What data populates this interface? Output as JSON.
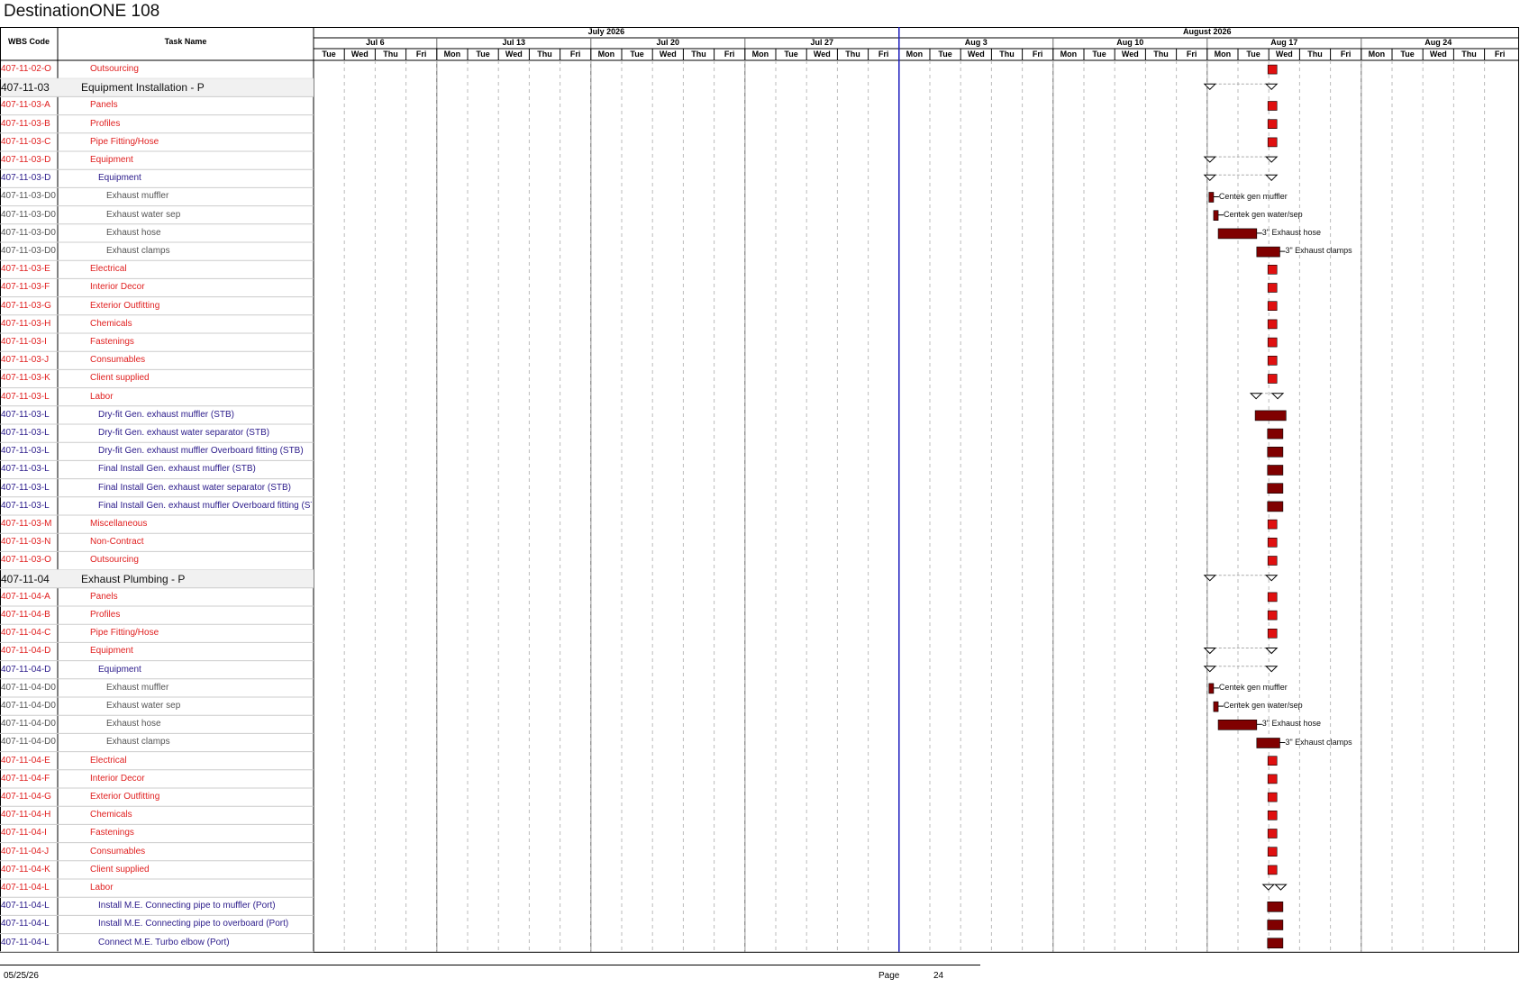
{
  "title": "DestinationONE 108",
  "columns": {
    "wbs": "WBS Code",
    "task": "Task Name"
  },
  "months": [
    "July 2026",
    "August 2026"
  ],
  "weeks": [
    "Jul 6",
    "Jul 13",
    "Jul 20",
    "Jul 27",
    "Aug 3",
    "Aug 10",
    "Aug 17",
    "Aug 24"
  ],
  "days": [
    "Tue",
    "Wed",
    "Thu",
    "Fri",
    "Mon",
    "Tue",
    "Wed",
    "Thu",
    "Fri",
    "Mon",
    "Tue",
    "Wed",
    "Thu",
    "Fri",
    "Mon",
    "Tue",
    "Wed",
    "Thu",
    "Fri",
    "Mon",
    "Tue",
    "Wed",
    "Thu",
    "Fri",
    "Mon",
    "Tue",
    "Wed",
    "Thu",
    "Fri",
    "Mon",
    "Tue",
    "Wed",
    "Thu",
    "Fri",
    "Mon",
    "Tue",
    "Wed",
    "Thu",
    "Fri"
  ],
  "colors": {
    "red_text": "#e02020",
    "blue_text": "#2a1a8a",
    "milestone": "#e01010",
    "task_bar": "#800000",
    "today_line": "#2020c0"
  },
  "rows": [
    {
      "wbs": "407-11-02-O",
      "task": "Outsourcing",
      "style": "red",
      "indent": 1,
      "bar": {
        "kind": "milestone",
        "day": 31
      }
    },
    {
      "wbs": "407-11-03",
      "task": "Equipment Installation - P",
      "style": "big",
      "indent": 0,
      "bar": {
        "kind": "summary",
        "start": 29,
        "end": 31
      }
    },
    {
      "wbs": "407-11-03-A",
      "task": "Panels",
      "style": "red",
      "indent": 1,
      "bar": {
        "kind": "milestone",
        "day": 31
      }
    },
    {
      "wbs": "407-11-03-B",
      "task": "Profiles",
      "style": "red",
      "indent": 1,
      "bar": {
        "kind": "milestone",
        "day": 31
      }
    },
    {
      "wbs": "407-11-03-C",
      "task": "Pipe Fitting/Hose",
      "style": "red",
      "indent": 1,
      "bar": {
        "kind": "milestone",
        "day": 31
      }
    },
    {
      "wbs": "407-11-03-D",
      "task": "Equipment",
      "style": "red",
      "indent": 1,
      "bar": {
        "kind": "summary",
        "start": 29,
        "end": 31
      }
    },
    {
      "wbs": "407-11-03-D",
      "task": "Equipment",
      "style": "blue",
      "indent": 2,
      "bar": {
        "kind": "summary",
        "start": 29,
        "end": 31
      }
    },
    {
      "wbs": "407-11-03-D0",
      "task": "Exhaust muffler",
      "style": "gray",
      "indent": 3,
      "bar": {
        "kind": "task",
        "start": 29.0,
        "end": 29.15,
        "label": "Centek gen muffler"
      }
    },
    {
      "wbs": "407-11-03-D0",
      "task": "Exhaust water sep",
      "style": "gray",
      "indent": 3,
      "bar": {
        "kind": "task",
        "start": 29.15,
        "end": 29.3,
        "label": "Centek gen water/sep"
      }
    },
    {
      "wbs": "407-11-03-D0",
      "task": "Exhaust hose",
      "style": "gray",
      "indent": 3,
      "bar": {
        "kind": "task",
        "start": 29.3,
        "end": 30.55,
        "label": "3\" Exhaust hose"
      }
    },
    {
      "wbs": "407-11-03-D0",
      "task": "Exhaust clamps",
      "style": "gray",
      "indent": 3,
      "bar": {
        "kind": "task",
        "start": 30.55,
        "end": 31.3,
        "label": "3\" Exhaust clamps"
      }
    },
    {
      "wbs": "407-11-03-E",
      "task": "Electrical",
      "style": "red",
      "indent": 1,
      "bar": {
        "kind": "milestone",
        "day": 31
      }
    },
    {
      "wbs": "407-11-03-F",
      "task": "Interior Decor",
      "style": "red",
      "indent": 1,
      "bar": {
        "kind": "milestone",
        "day": 31
      }
    },
    {
      "wbs": "407-11-03-G",
      "task": "Exterior Outfitting",
      "style": "red",
      "indent": 1,
      "bar": {
        "kind": "milestone",
        "day": 31
      }
    },
    {
      "wbs": "407-11-03-H",
      "task": "Chemicals",
      "style": "red",
      "indent": 1,
      "bar": {
        "kind": "milestone",
        "day": 31
      }
    },
    {
      "wbs": "407-11-03-I",
      "task": "Fastenings",
      "style": "red",
      "indent": 1,
      "bar": {
        "kind": "milestone",
        "day": 31
      }
    },
    {
      "wbs": "407-11-03-J",
      "task": "Consumables",
      "style": "red",
      "indent": 1,
      "bar": {
        "kind": "milestone",
        "day": 31
      }
    },
    {
      "wbs": "407-11-03-K",
      "task": "Client supplied",
      "style": "red",
      "indent": 1,
      "bar": {
        "kind": "milestone",
        "day": 31
      }
    },
    {
      "wbs": "407-11-03-L",
      "task": "Labor",
      "style": "red",
      "indent": 1,
      "bar": {
        "kind": "summary",
        "start": 30.5,
        "end": 31.2
      }
    },
    {
      "wbs": "407-11-03-L",
      "task": "Dry-fit Gen. exhaust muffler (STB)",
      "style": "blue",
      "indent": 2,
      "bar": {
        "kind": "task",
        "start": 30.5,
        "end": 31.5
      }
    },
    {
      "wbs": "407-11-03-L",
      "task": "Dry-fit Gen. exhaust water separator (STB)",
      "style": "blue",
      "indent": 2,
      "bar": {
        "kind": "task",
        "start": 30.9,
        "end": 31.4
      }
    },
    {
      "wbs": "407-11-03-L",
      "task": "Dry-fit Gen. exhaust muffler Overboard fitting (STB)",
      "style": "blue",
      "indent": 2,
      "bar": {
        "kind": "task",
        "start": 30.9,
        "end": 31.4
      }
    },
    {
      "wbs": "407-11-03-L",
      "task": "Final Install Gen. exhaust muffler (STB)",
      "style": "blue",
      "indent": 2,
      "bar": {
        "kind": "task",
        "start": 30.9,
        "end": 31.4
      }
    },
    {
      "wbs": "407-11-03-L",
      "task": "Final Install Gen. exhaust water separator (STB)",
      "style": "blue",
      "indent": 2,
      "bar": {
        "kind": "task",
        "start": 30.9,
        "end": 31.4
      }
    },
    {
      "wbs": "407-11-03-L",
      "task": "Final Install Gen. exhaust muffler Overboard fitting (STB)",
      "style": "blue",
      "indent": 2,
      "bar": {
        "kind": "task",
        "start": 30.9,
        "end": 31.4
      }
    },
    {
      "wbs": "407-11-03-M",
      "task": "Miscellaneous",
      "style": "red",
      "indent": 1,
      "bar": {
        "kind": "milestone",
        "day": 31
      }
    },
    {
      "wbs": "407-11-03-N",
      "task": "Non-Contract",
      "style": "red",
      "indent": 1,
      "bar": {
        "kind": "milestone",
        "day": 31
      }
    },
    {
      "wbs": "407-11-03-O",
      "task": "Outsourcing",
      "style": "red",
      "indent": 1,
      "bar": {
        "kind": "milestone",
        "day": 31
      }
    },
    {
      "wbs": "407-11-04",
      "task": "Exhaust Plumbing - P",
      "style": "big",
      "indent": 0,
      "bar": {
        "kind": "summary",
        "start": 29,
        "end": 31
      }
    },
    {
      "wbs": "407-11-04-A",
      "task": "Panels",
      "style": "red",
      "indent": 1,
      "bar": {
        "kind": "milestone",
        "day": 31
      }
    },
    {
      "wbs": "407-11-04-B",
      "task": "Profiles",
      "style": "red",
      "indent": 1,
      "bar": {
        "kind": "milestone",
        "day": 31
      }
    },
    {
      "wbs": "407-11-04-C",
      "task": "Pipe Fitting/Hose",
      "style": "red",
      "indent": 1,
      "bar": {
        "kind": "milestone",
        "day": 31
      }
    },
    {
      "wbs": "407-11-04-D",
      "task": "Equipment",
      "style": "red",
      "indent": 1,
      "bar": {
        "kind": "summary",
        "start": 29,
        "end": 31
      }
    },
    {
      "wbs": "407-11-04-D",
      "task": "Equipment",
      "style": "blue",
      "indent": 2,
      "bar": {
        "kind": "summary",
        "start": 29,
        "end": 31
      }
    },
    {
      "wbs": "407-11-04-D0",
      "task": "Exhaust muffler",
      "style": "gray",
      "indent": 3,
      "bar": {
        "kind": "task",
        "start": 29.0,
        "end": 29.15,
        "label": "Centek gen muffler"
      }
    },
    {
      "wbs": "407-11-04-D0",
      "task": "Exhaust water sep",
      "style": "gray",
      "indent": 3,
      "bar": {
        "kind": "task",
        "start": 29.15,
        "end": 29.3,
        "label": "Centek gen water/sep"
      }
    },
    {
      "wbs": "407-11-04-D0",
      "task": "Exhaust hose",
      "style": "gray",
      "indent": 3,
      "bar": {
        "kind": "task",
        "start": 29.3,
        "end": 30.55,
        "label": "3\" Exhaust hose"
      }
    },
    {
      "wbs": "407-11-04-D0",
      "task": "Exhaust clamps",
      "style": "gray",
      "indent": 3,
      "bar": {
        "kind": "task",
        "start": 30.55,
        "end": 31.3,
        "label": "3\" Exhaust clamps"
      }
    },
    {
      "wbs": "407-11-04-E",
      "task": "Electrical",
      "style": "red",
      "indent": 1,
      "bar": {
        "kind": "milestone",
        "day": 31
      }
    },
    {
      "wbs": "407-11-04-F",
      "task": "Interior Decor",
      "style": "red",
      "indent": 1,
      "bar": {
        "kind": "milestone",
        "day": 31
      }
    },
    {
      "wbs": "407-11-04-G",
      "task": "Exterior Outfitting",
      "style": "red",
      "indent": 1,
      "bar": {
        "kind": "milestone",
        "day": 31
      }
    },
    {
      "wbs": "407-11-04-H",
      "task": "Chemicals",
      "style": "red",
      "indent": 1,
      "bar": {
        "kind": "milestone",
        "day": 31
      }
    },
    {
      "wbs": "407-11-04-I",
      "task": "Fastenings",
      "style": "red",
      "indent": 1,
      "bar": {
        "kind": "milestone",
        "day": 31
      }
    },
    {
      "wbs": "407-11-04-J",
      "task": "Consumables",
      "style": "red",
      "indent": 1,
      "bar": {
        "kind": "milestone",
        "day": 31
      }
    },
    {
      "wbs": "407-11-04-K",
      "task": "Client supplied",
      "style": "red",
      "indent": 1,
      "bar": {
        "kind": "milestone",
        "day": 31
      }
    },
    {
      "wbs": "407-11-04-L",
      "task": "Labor",
      "style": "red",
      "indent": 1,
      "bar": {
        "kind": "summary",
        "start": 30.9,
        "end": 31.3
      }
    },
    {
      "wbs": "407-11-04-L",
      "task": "Install M.E. Connecting pipe to muffler (Port)",
      "style": "blue",
      "indent": 2,
      "bar": {
        "kind": "task",
        "start": 30.9,
        "end": 31.4
      }
    },
    {
      "wbs": "407-11-04-L",
      "task": "Install M.E. Connecting pipe to overboard (Port)",
      "style": "blue",
      "indent": 2,
      "bar": {
        "kind": "task",
        "start": 30.9,
        "end": 31.4
      }
    },
    {
      "wbs": "407-11-04-L",
      "task": "Connect M.E. Turbo elbow (Port)",
      "style": "blue",
      "indent": 2,
      "bar": {
        "kind": "task",
        "start": 30.9,
        "end": 31.4
      }
    }
  ],
  "today_day": 19,
  "footer": {
    "date": "05/25/26",
    "page_label": "Page",
    "page_number": "24"
  }
}
